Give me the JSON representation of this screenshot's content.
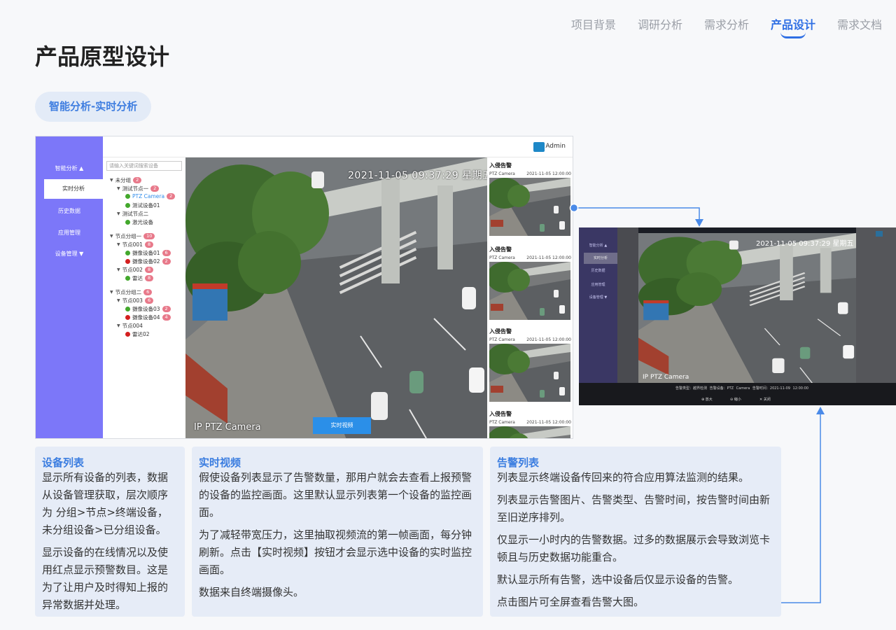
{
  "nav": {
    "items": [
      "项目背景",
      "调研分析",
      "需求分析",
      "产品设计",
      "需求文档"
    ],
    "active_index": 3
  },
  "page_title": "产品原型设计",
  "section_label": "智能分析-实时分析",
  "mockup": {
    "header": {
      "user": "Admin"
    },
    "sidebar": {
      "items": [
        "智能分析 ▲",
        "实时分析",
        "历史数据",
        "应用管理",
        "设备管理 ▼"
      ],
      "active_index": 1
    },
    "device_tree": {
      "search_placeholder": "请输入关键词搜索设备",
      "rows": [
        {
          "label": "未分组",
          "badge": "2",
          "type": "group"
        },
        {
          "label": "测试节点一",
          "badge": "2",
          "type": "node"
        },
        {
          "label": "PTZ Camera",
          "badge": "2",
          "type": "device",
          "status": "online",
          "selected": true
        },
        {
          "label": "测试设备01",
          "badge": "",
          "type": "device",
          "status": "online"
        },
        {
          "label": "测试节点二",
          "badge": "",
          "type": "node"
        },
        {
          "label": "激光设备",
          "badge": "",
          "type": "device",
          "status": "online"
        },
        {
          "label": "节点分组一",
          "badge": "10",
          "type": "group"
        },
        {
          "label": "节点001",
          "badge": "8",
          "type": "node"
        },
        {
          "label": "摄像设备01",
          "badge": "6",
          "type": "device",
          "status": "online"
        },
        {
          "label": "摄像设备02",
          "badge": "2",
          "type": "device",
          "status": "offline"
        },
        {
          "label": "节点002",
          "badge": "8",
          "type": "node"
        },
        {
          "label": "雷达",
          "badge": "8",
          "type": "device",
          "status": "online"
        },
        {
          "label": "节点分组二",
          "badge": "6",
          "type": "group"
        },
        {
          "label": "节点003",
          "badge": "6",
          "type": "node"
        },
        {
          "label": "摄像设备03",
          "badge": "2",
          "type": "device",
          "status": "online"
        },
        {
          "label": "摄像设备04",
          "badge": "4",
          "type": "device",
          "status": "offline"
        },
        {
          "label": "节点004",
          "badge": "",
          "type": "node"
        },
        {
          "label": "雷达02",
          "badge": "",
          "type": "device",
          "status": "offline"
        }
      ]
    },
    "video": {
      "timestamp": "2021-11-05 09:37:29 星期五",
      "camera_label": "IP PTZ Camera",
      "live_button": "实时视频"
    },
    "alerts": [
      {
        "title": "入侵告警",
        "device": "PTZ Camera",
        "time": "2021-11-05 12:00:00"
      },
      {
        "title": "入侵告警",
        "device": "PTZ Camera",
        "time": "2021-11-05 12:00:00"
      },
      {
        "title": "入侵告警",
        "device": "PTZ Camera",
        "time": "2021-11-05 12:00:00"
      },
      {
        "title": "入侵告警",
        "device": "PTZ Camera",
        "time": "2021-11-05 12:00:00"
      }
    ]
  },
  "zoom_preview": {
    "timestamp": "2021-11-05 09:37:29 星期五",
    "camera_label": "IP PTZ Camera",
    "info": "告警类型：越界检测    告警设备：PTZ Camera    告警时间：2021-11-09 12:00:00",
    "controls": [
      "⊕ 放大",
      "⊖ 缩小",
      "✕ 关闭"
    ],
    "sidebar": [
      "智能分析 ▲",
      "实时分析",
      "历史数据",
      "应用管理",
      "设备管理 ▼"
    ]
  },
  "cards": [
    {
      "title": "设备列表",
      "paragraphs": [
        "显示所有设备的列表，数据从设备管理获取，层次顺序为 分组>节点>终端设备，未分组设备>已分组设备。",
        "显示设备的在线情况以及使用红点显示预警数目。这是为了让用户及时得知上报的异常数据并处理。"
      ]
    },
    {
      "title": "实时视频",
      "paragraphs": [
        "假使设备列表显示了告警数量，那用户就会去查看上报预警的设备的监控画面。这里默认显示列表第一个设备的监控画面。",
        "为了减轻带宽压力，这里抽取视频流的第一帧画面，每分钟刷新。点击【实时视频】按钮才会显示选中设备的实时监控画面。",
        "数据来自终端摄像头。"
      ]
    },
    {
      "title": "告警列表",
      "paragraphs": [
        "列表显示终端设备传回来的符合应用算法监测的结果。",
        "列表显示告警图片、告警类型、告警时间，按告警时间由新至旧逆序排列。",
        "仅显示一小时内的告警数据。过多的数据展示会导致浏览卡顿且与历史数据功能重合。",
        "默认显示所有告警，选中设备后仅显示设备的告警。",
        "点击图片可全屏查看告警大图。"
      ]
    }
  ],
  "colors": {
    "accent": "#2f6fe4",
    "sidebar": "#7c77f9",
    "card_bg": "#e6ecf7",
    "online": "#43a82c",
    "offline": "#d41f1f",
    "badge": "#e8798a"
  }
}
